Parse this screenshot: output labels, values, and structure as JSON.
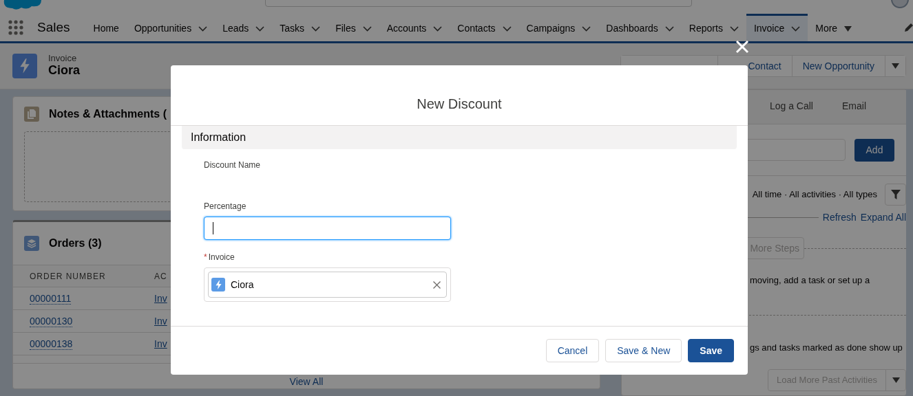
{
  "app": {
    "name": "Sales"
  },
  "nav": [
    {
      "label": "Home",
      "kind": "link",
      "selected": false
    },
    {
      "label": "Opportunities",
      "kind": "menu",
      "selected": false
    },
    {
      "label": "Leads",
      "kind": "menu",
      "selected": false
    },
    {
      "label": "Tasks",
      "kind": "menu",
      "selected": false
    },
    {
      "label": "Files",
      "kind": "menu",
      "selected": false
    },
    {
      "label": "Accounts",
      "kind": "menu",
      "selected": false
    },
    {
      "label": "Contacts",
      "kind": "menu",
      "selected": false
    },
    {
      "label": "Campaigns",
      "kind": "menu",
      "selected": false
    },
    {
      "label": "Dashboards",
      "kind": "menu",
      "selected": false
    },
    {
      "label": "Reports",
      "kind": "menu",
      "selected": false
    },
    {
      "label": "Invoice",
      "kind": "menu",
      "selected": true
    },
    {
      "label": "More",
      "kind": "more",
      "selected": false
    }
  ],
  "record": {
    "type": "Invoice",
    "name": "Ciora",
    "buttons": [
      {
        "label": "Contact"
      },
      {
        "label": "New Opportunity"
      }
    ]
  },
  "notes_card": {
    "title": "Notes & Attachments ("
  },
  "orders_card": {
    "title": "Orders (3)",
    "columns": [
      "ORDER NUMBER",
      "AC"
    ],
    "rows": [
      [
        "00000111",
        "Inv"
      ],
      [
        "00000130",
        "Inv"
      ],
      [
        "00000138",
        "Inv"
      ]
    ],
    "footer_link": "View All"
  },
  "activity": {
    "tabs": [
      {
        "label": "Log a Call",
        "selected": false
      },
      {
        "label": "Email",
        "selected": false
      }
    ],
    "add_button": "Add",
    "filter_text": "All time · All activities · All types",
    "links": [
      "Refresh",
      "Expand All"
    ],
    "more_steps_button": "More Steps",
    "upcoming_text": "moving, add a task or set up a",
    "past_text": "gs and tasks marked as done show up",
    "load_more_button": "Load More Past Activities"
  },
  "modal": {
    "title": "New Discount",
    "section": "Information",
    "fields": [
      {
        "kind": "static",
        "label": "Discount Name"
      },
      {
        "kind": "text",
        "label": "Percentage",
        "focused": true
      },
      {
        "kind": "lookup",
        "label": "Invoice",
        "required_mark": "*",
        "value": "Ciora"
      }
    ],
    "buttons": [
      {
        "label": "Cancel",
        "kind": "neutral"
      },
      {
        "label": "Save & New",
        "kind": "neutral"
      },
      {
        "label": "Save",
        "kind": "brand"
      }
    ]
  }
}
